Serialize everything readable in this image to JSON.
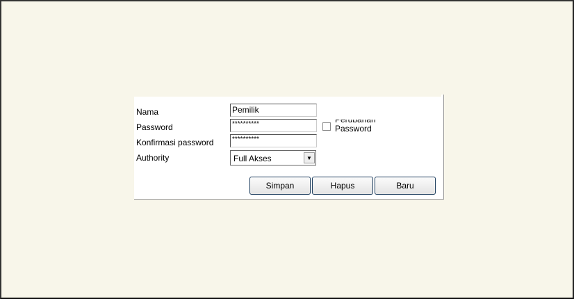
{
  "form": {
    "nama_label": "Nama",
    "nama_value": "Pemilik",
    "password_label": "Password",
    "password_value": "**********",
    "konfirmasi_label": "Konfirmasi password",
    "konfirmasi_value": "**********",
    "authority_label": "Authority",
    "authority_value": "Full Akses",
    "perubahan_label": "Perubahan Password",
    "perubahan_checked": false
  },
  "buttons": {
    "simpan": "Simpan",
    "hapus": "Hapus",
    "baru": "Baru"
  }
}
